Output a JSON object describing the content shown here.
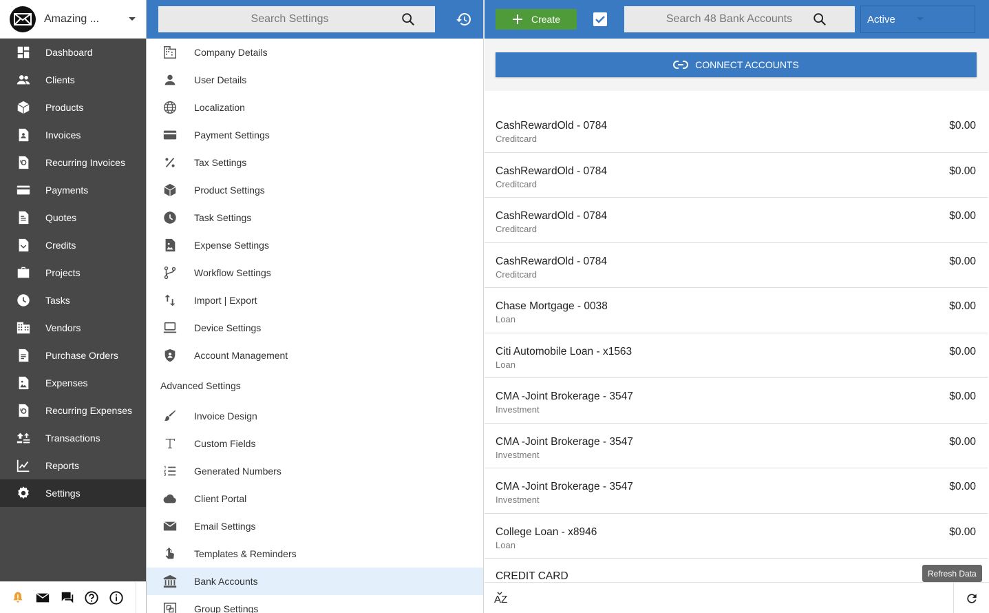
{
  "company": {
    "name": "Amazing ..."
  },
  "nav": {
    "items": [
      {
        "label": "Dashboard",
        "icon": "dashboard-icon"
      },
      {
        "label": "Clients",
        "icon": "clients-icon"
      },
      {
        "label": "Products",
        "icon": "products-icon"
      },
      {
        "label": "Invoices",
        "icon": "invoices-icon"
      },
      {
        "label": "Recurring Invoices",
        "icon": "recurring-invoices-icon"
      },
      {
        "label": "Payments",
        "icon": "payments-icon"
      },
      {
        "label": "Quotes",
        "icon": "quotes-icon"
      },
      {
        "label": "Credits",
        "icon": "credits-icon"
      },
      {
        "label": "Projects",
        "icon": "projects-icon"
      },
      {
        "label": "Tasks",
        "icon": "tasks-icon"
      },
      {
        "label": "Vendors",
        "icon": "vendors-icon"
      },
      {
        "label": "Purchase Orders",
        "icon": "purchase-orders-icon"
      },
      {
        "label": "Expenses",
        "icon": "expenses-icon"
      },
      {
        "label": "Recurring Expenses",
        "icon": "recurring-expenses-icon"
      },
      {
        "label": "Transactions",
        "icon": "transactions-icon"
      },
      {
        "label": "Reports",
        "icon": "reports-icon"
      },
      {
        "label": "Settings",
        "icon": "settings-icon",
        "active": true
      }
    ],
    "footer_icons": [
      "warning-icon",
      "mail-icon",
      "chat-icon",
      "help-icon",
      "info-icon"
    ]
  },
  "settings": {
    "search_placeholder": "Search Settings",
    "basic": [
      {
        "label": "Company Details",
        "icon": "building-icon"
      },
      {
        "label": "User Details",
        "icon": "user-icon"
      },
      {
        "label": "Localization",
        "icon": "globe-icon"
      },
      {
        "label": "Payment Settings",
        "icon": "credit-card-icon"
      },
      {
        "label": "Tax Settings",
        "icon": "percent-icon"
      },
      {
        "label": "Product Settings",
        "icon": "box-icon"
      },
      {
        "label": "Task Settings",
        "icon": "clock-icon"
      },
      {
        "label": "Expense Settings",
        "icon": "receipt-image-icon"
      },
      {
        "label": "Workflow Settings",
        "icon": "workflow-icon"
      },
      {
        "label": "Import | Export",
        "icon": "import-export-icon"
      },
      {
        "label": "Device Settings",
        "icon": "laptop-icon"
      },
      {
        "label": "Account Management",
        "icon": "shield-user-icon"
      }
    ],
    "advanced_header": "Advanced Settings",
    "advanced": [
      {
        "label": "Invoice Design",
        "icon": "brush-icon"
      },
      {
        "label": "Custom Fields",
        "icon": "text-icon"
      },
      {
        "label": "Generated Numbers",
        "icon": "numbered-list-icon"
      },
      {
        "label": "Client Portal",
        "icon": "cloud-icon"
      },
      {
        "label": "Email Settings",
        "icon": "mail-icon"
      },
      {
        "label": "Templates & Reminders",
        "icon": "touch-icon"
      },
      {
        "label": "Bank Accounts",
        "icon": "bank-icon",
        "active": true
      },
      {
        "label": "Group Settings",
        "icon": "group-icon"
      }
    ]
  },
  "bank": {
    "create_label": "Create",
    "search_placeholder": "Search 48 Bank Accounts",
    "status": "Active",
    "connect_label": "CONNECT ACCOUNTS",
    "accounts": [
      {
        "name": "CashRewardOld - 0784",
        "type": "Creditcard",
        "balance": "$0.00"
      },
      {
        "name": "CashRewardOld - 0784",
        "type": "Creditcard",
        "balance": "$0.00"
      },
      {
        "name": "CashRewardOld - 0784",
        "type": "Creditcard",
        "balance": "$0.00"
      },
      {
        "name": "CashRewardOld - 0784",
        "type": "Creditcard",
        "balance": "$0.00"
      },
      {
        "name": "Chase Mortgage - 0038",
        "type": "Loan",
        "balance": "$0.00"
      },
      {
        "name": "Citi Automobile Loan - x1563",
        "type": "Loan",
        "balance": "$0.00"
      },
      {
        "name": "CMA -Joint Brokerage - 3547",
        "type": "Investment",
        "balance": "$0.00"
      },
      {
        "name": "CMA -Joint Brokerage - 3547",
        "type": "Investment",
        "balance": "$0.00"
      },
      {
        "name": "CMA -Joint Brokerage - 3547",
        "type": "Investment",
        "balance": "$0.00"
      },
      {
        "name": "College Loan - x8946",
        "type": "Loan",
        "balance": "$0.00"
      }
    ],
    "partial_row_name": "CREDIT CARD",
    "sort_label": "AZ",
    "tooltip": "Refresh Data"
  },
  "colors": {
    "primary": "#3a7ac2",
    "create_green": "#4f9a39",
    "nav_bg": "#484848",
    "active_settings_bg": "#e3f0fb",
    "warning": "#f0a030"
  }
}
